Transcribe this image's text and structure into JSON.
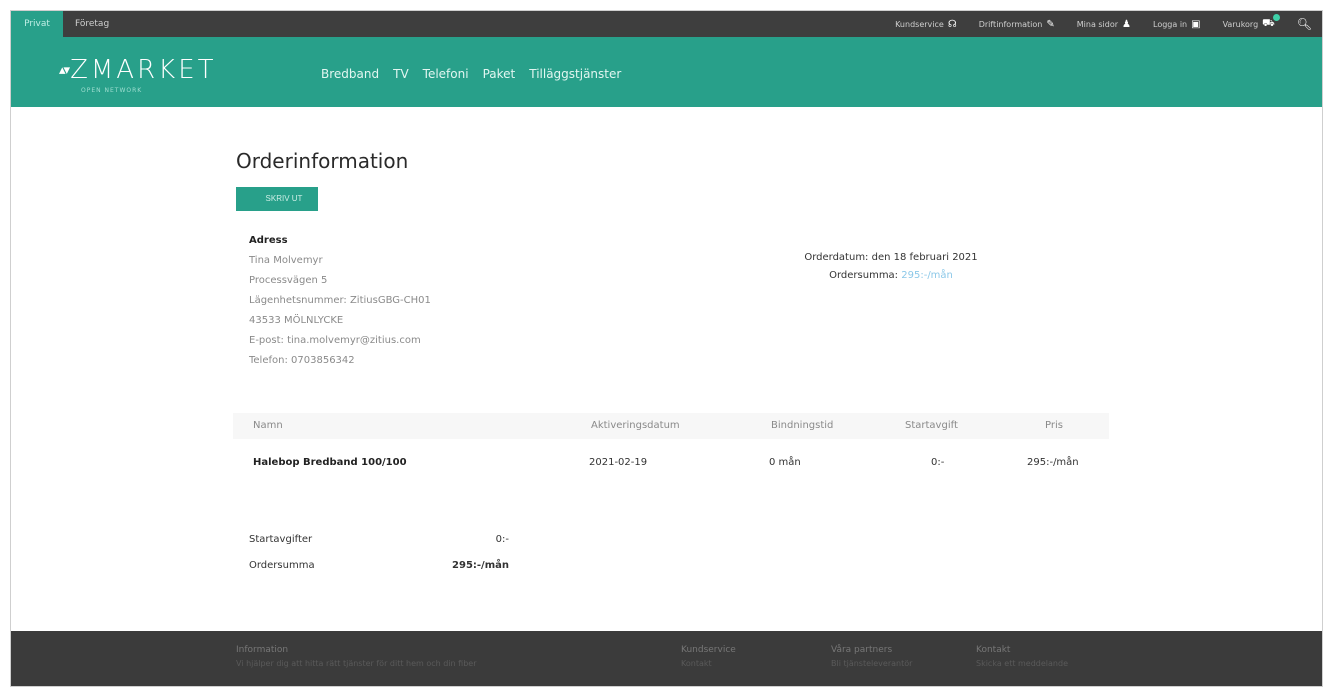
{
  "topbar": {
    "private_label": "Privat",
    "company_label": "Företag",
    "links": [
      {
        "label": "Kundservice",
        "icon": "headset-icon",
        "glyph": "☊"
      },
      {
        "label": "Driftinformation",
        "icon": "wrench-icon",
        "glyph": "✎"
      },
      {
        "label": "Mina sidor",
        "icon": "user-icon",
        "glyph": "♟"
      },
      {
        "label": "Logga in",
        "icon": "lock-icon",
        "glyph": "▣"
      },
      {
        "label": "Varukorg",
        "icon": "cart-icon",
        "glyph": "⛟"
      }
    ]
  },
  "header": {
    "logo_mark": "▴▾",
    "logo_text": "ZMARKET",
    "logo_sub": "OPEN NETWORK",
    "nav": [
      "Bredband",
      "TV",
      "Telefoni",
      "Paket",
      "Tilläggstjänster"
    ]
  },
  "order": {
    "title": "Orderinformation",
    "print_button": "SKRIV UT",
    "address": {
      "label": "Adress",
      "name": "Tina Molvemyr",
      "street": "Processvägen 5",
      "apartment": "Lägenhetsnummer: ZitiusGBG-CH01",
      "postal": "43533 MÖLNLYCKE",
      "email": "E-post: tina.molvemyr@zitius.com",
      "phone": "Telefon: 0703856342"
    },
    "order_date": "Orderdatum: den 18 februari 2021",
    "order_sum_label": "Ordersumma:",
    "order_sum_value": "295:-/mån"
  },
  "table": {
    "headers": [
      "Namn",
      "Aktiveringsdatum",
      "Bindningstid",
      "Startavgift",
      "Pris"
    ],
    "rows": [
      {
        "name": "Halebop Bredband 100/100",
        "activation": "2021-02-19",
        "binding": "0 mån",
        "startfee": "0:-",
        "price": "295:-/mån"
      }
    ]
  },
  "totals": {
    "startfees_label": "Startavgifter",
    "startfees_value": "0:-",
    "ordersum_label": "Ordersumma",
    "ordersum_value": "295:-/mån"
  },
  "footer": {
    "info_heading": "Information",
    "info_text": "Vi hjälper dig att hitta rätt tjänster för ditt hem och din fiber",
    "kundservice_heading": "Kundservice",
    "kundservice_text": "Kontakt",
    "partners_heading": "Våra partners",
    "partners_text": "Bli tjänsteleverantör",
    "contact_heading": "Kontakt",
    "contact_text": "Skicka ett meddelande"
  },
  "colors": {
    "brand": "#28a08a",
    "topbar": "#3e3e3e",
    "footer": "#3b3b3b",
    "sum_link": "#8cc8e8"
  }
}
